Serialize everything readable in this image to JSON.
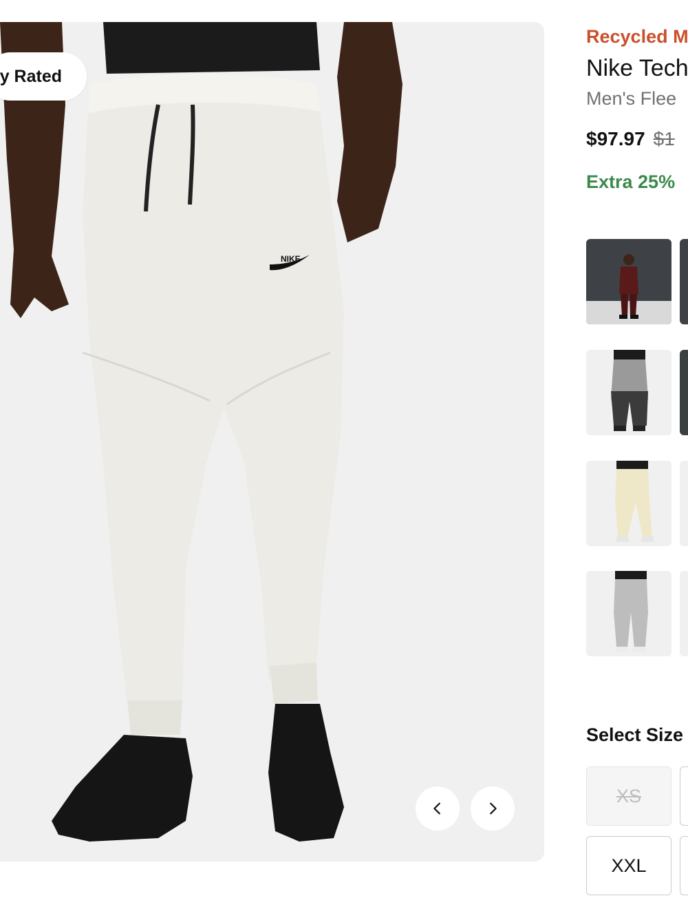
{
  "hero": {
    "badge_text": "Highly Rated",
    "prev_icon": "chevron-left-icon",
    "next_icon": "chevron-right-icon",
    "swoosh_text": "NIKE"
  },
  "product": {
    "promo_label": "Recycled M",
    "name": "Nike Tech",
    "subtitle": "Men's Flee",
    "price_current": "$97.97",
    "price_old": "$1",
    "promo_text": "Extra 25%"
  },
  "thumbnails": [
    {
      "label": "burgundy tracksuit"
    },
    {
      "label": "grey colorblock joggers"
    },
    {
      "label": "cream joggers"
    },
    {
      "label": "heather grey joggers"
    }
  ],
  "sizes": {
    "heading": "Select Size",
    "options": [
      {
        "label": "XS",
        "available": false
      },
      {
        "label": "XXL",
        "available": true
      }
    ]
  },
  "colors": {
    "promo": "#c9502b",
    "discount": "#3a8a4a",
    "muted": "#707072"
  }
}
